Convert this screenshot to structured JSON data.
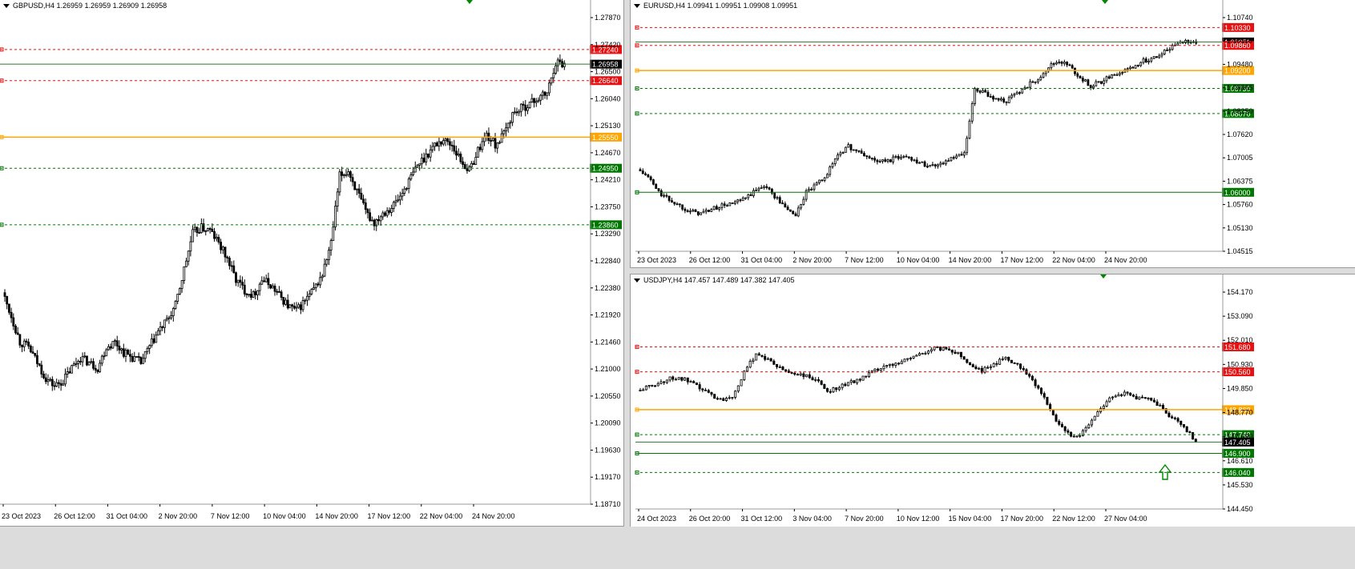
{
  "colors": {
    "bull": "#00ff00",
    "bull_border": "#000000",
    "bear": "#ff0000",
    "bear_border": "#000000",
    "candle_bull_fill": "#ffffff",
    "candle_bear_fill": "#000000",
    "level_red": "#e81010",
    "level_orange": "#ffa500",
    "level_green": "#007700",
    "current_price": "#000000",
    "frame": "#999999"
  },
  "windows": [
    {
      "id": "gbpusd",
      "header": "GBPUSD,H4  1.26959 1.26959 1.26909 1.26958",
      "price_scale": [
        "1.27870",
        "1.27420",
        "1.26500",
        "1.26040",
        "1.25130",
        "1.24670",
        "1.24210",
        "1.23750",
        "1.23290",
        "1.22840",
        "1.22380",
        "1.21920",
        "1.21460",
        "1.21000",
        "1.20550",
        "1.20090",
        "1.19630",
        "1.19170",
        "1.18710"
      ],
      "time_scale": [
        "23 Oct 2023",
        "26 Oct 12:00",
        "31 Oct 04:00",
        "2 Nov 20:00",
        "7 Nov 12:00",
        "10 Nov 04:00",
        "14 Nov 20:00",
        "17 Nov 12:00",
        "22 Nov 04:00",
        "24 Nov 20:00"
      ],
      "levels": [
        {
          "price": 1.2724,
          "label": "1.27240",
          "color": "red",
          "style": "dash"
        },
        {
          "price": 1.26958,
          "label": "1.26958",
          "color": "current",
          "style": "solid"
        },
        {
          "price": 1.2664,
          "label": "1.26640",
          "color": "red",
          "style": "dash"
        },
        {
          "price": 1.2555,
          "label": "1.25550",
          "color": "orange",
          "style": "solid"
        },
        {
          "price": 1.2495,
          "label": "1.24950",
          "color": "green",
          "style": "dash"
        },
        {
          "price": 1.2386,
          "label": "1.23860",
          "color": "green",
          "style": "dash"
        }
      ],
      "range": [
        1.1847,
        1.2801
      ],
      "path": [
        1.2255,
        1.221,
        1.216,
        1.215,
        1.212,
        1.209,
        1.2075,
        1.2085,
        1.211,
        1.213,
        1.212,
        1.211,
        1.215,
        1.216,
        1.214,
        1.213,
        1.212,
        1.215,
        1.218,
        1.22,
        1.223,
        1.23,
        1.237,
        1.238,
        1.2375,
        1.235,
        1.232,
        1.228,
        1.226,
        1.225,
        1.228,
        1.227,
        1.225,
        1.223,
        1.222,
        1.224,
        1.226,
        1.229,
        1.235,
        1.248,
        1.249,
        1.245,
        1.241,
        1.239,
        1.241,
        1.242,
        1.244,
        1.247,
        1.25,
        1.252,
        1.254,
        1.255,
        1.254,
        1.251,
        1.249,
        1.253,
        1.256,
        1.254,
        1.256,
        1.26,
        1.261,
        1.262,
        1.263,
        1.264,
        1.27,
        1.2696
      ]
    },
    {
      "id": "eurusd",
      "header": "EURUSD,H4  1.09941 1.09951 1.09908 1.09951",
      "price_scale": [
        "1.10740",
        "1.10110",
        "1.09480",
        "1.08865",
        "1.08250",
        "1.07620",
        "1.07005",
        "1.06375",
        "1.05760",
        "1.05130",
        "1.04515"
      ],
      "time_scale": [
        "23 Oct 2023",
        "26 Oct 12:00",
        "31 Oct 04:00",
        "2 Nov 20:00",
        "7 Nov 12:00",
        "10 Nov 04:00",
        "14 Nov 20:00",
        "17 Nov 12:00",
        "22 Nov 04:00",
        "24 Nov 20:00"
      ],
      "levels": [
        {
          "price": 1.1033,
          "label": "1.10330",
          "color": "red",
          "style": "dash"
        },
        {
          "price": 1.0995,
          "label": "1.09951",
          "color": "current",
          "style": "solid"
        },
        {
          "price": 1.0986,
          "label": "1.09860",
          "color": "red",
          "style": "dash"
        },
        {
          "price": 1.092,
          "label": "1.09200",
          "color": "orange",
          "style": "solid"
        },
        {
          "price": 1.0873,
          "label": "1.08730",
          "color": "green",
          "style": "dash"
        },
        {
          "price": 1.0807,
          "label": "1.08070",
          "color": "green",
          "style": "dash"
        },
        {
          "price": 1.06,
          "label": "1.06000",
          "color": "green",
          "style": "solid"
        }
      ],
      "range": [
        1.0445,
        1.108
      ],
      "path": [
        1.066,
        1.064,
        1.06,
        1.058,
        1.0565,
        1.055,
        1.0545,
        1.0555,
        1.0565,
        1.057,
        1.058,
        1.06,
        1.062,
        1.059,
        1.056,
        1.054,
        1.06,
        1.062,
        1.065,
        1.07,
        1.072,
        1.0705,
        1.069,
        1.068,
        1.0685,
        1.0695,
        1.069,
        1.0675,
        1.067,
        1.068,
        1.069,
        1.07,
        1.087,
        1.086,
        1.0845,
        1.084,
        1.086,
        1.088,
        1.09,
        1.093,
        1.0945,
        1.093,
        1.09,
        1.088,
        1.089,
        1.091,
        1.0915,
        1.093,
        1.0945,
        1.0955,
        1.097,
        1.099,
        1.1,
        1.0995
      ]
    },
    {
      "id": "usdjpy",
      "header": "USDJPY,H4  147.457 147.489 147.382 147.405",
      "price_scale": [
        "154.170",
        "153.090",
        "152.010",
        "150.930",
        "149.850",
        "148.770",
        "147.690",
        "146.610",
        "145.530",
        "144.450"
      ],
      "time_scale": [
        "24 Oct 2023",
        "26 Oct 20:00",
        "31 Oct 12:00",
        "3 Nov 04:00",
        "7 Nov 20:00",
        "10 Nov 12:00",
        "15 Nov 04:00",
        "17 Nov 20:00",
        "22 Nov 12:00",
        "27 Nov 04:00"
      ],
      "levels": [
        {
          "price": 151.68,
          "label": "151.680",
          "color": "red",
          "style": "dash"
        },
        {
          "price": 150.56,
          "label": "150.560",
          "color": "red",
          "style": "dash"
        },
        {
          "price": 148.86,
          "label": "148.860",
          "color": "orange",
          "style": "solid"
        },
        {
          "price": 147.74,
          "label": "147.740",
          "color": "green",
          "style": "dash"
        },
        {
          "price": 147.405,
          "label": "147.405",
          "color": "current",
          "style": "solid"
        },
        {
          "price": 146.9,
          "label": "146.900",
          "color": "green",
          "style": "solid"
        },
        {
          "price": 146.04,
          "label": "146.040",
          "color": "green",
          "style": "dash"
        }
      ],
      "range": [
        144.4,
        154.5
      ],
      "path": [
        149.7,
        149.9,
        150.1,
        150.3,
        150.2,
        149.9,
        149.6,
        149.3,
        149.5,
        150.5,
        151.4,
        151.1,
        150.7,
        150.5,
        150.4,
        150.2,
        149.7,
        149.9,
        150.1,
        150.3,
        150.6,
        150.8,
        151.0,
        151.2,
        151.4,
        151.6,
        151.6,
        151.4,
        150.9,
        150.6,
        150.9,
        151.2,
        150.9,
        150.4,
        149.6,
        148.6,
        147.9,
        147.6,
        148.2,
        148.9,
        149.5,
        149.6,
        149.4,
        149.3,
        149.0,
        148.5,
        148.1,
        147.4
      ]
    }
  ]
}
